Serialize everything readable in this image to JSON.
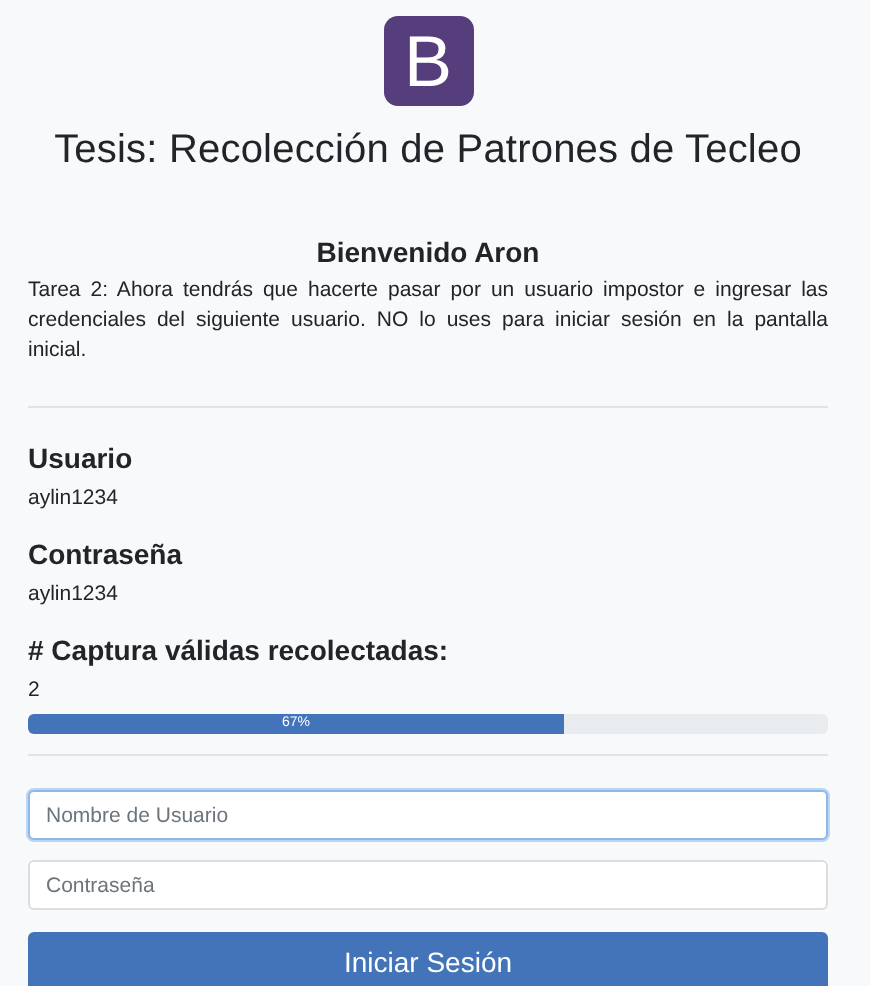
{
  "logo": {
    "letter": "B"
  },
  "title": "Tesis: Recolección de Patrones de Tecleo",
  "welcome": "Bienvenido Aron",
  "task": "Tarea 2: Ahora tendrás que hacerte pasar por un usuario impostor e ingresar las credenciales del siguiente usuario. NO lo uses para iniciar sesión en la pantalla inicial.",
  "credentials": [
    {
      "label": "Usuario",
      "value": "aylin1234"
    },
    {
      "label": "Contraseña",
      "value": "aylin1234"
    }
  ],
  "captures": {
    "label": "# Captura válidas recolectadas:",
    "count": "2",
    "level": 0.67,
    "percent": "67%"
  },
  "fields": [
    {
      "placeholder": "Nombre de Usuario",
      "focused": true
    },
    {
      "placeholder": "Contraseña",
      "focused": false
    }
  ],
  "submit": "Iniciar Sesión"
}
